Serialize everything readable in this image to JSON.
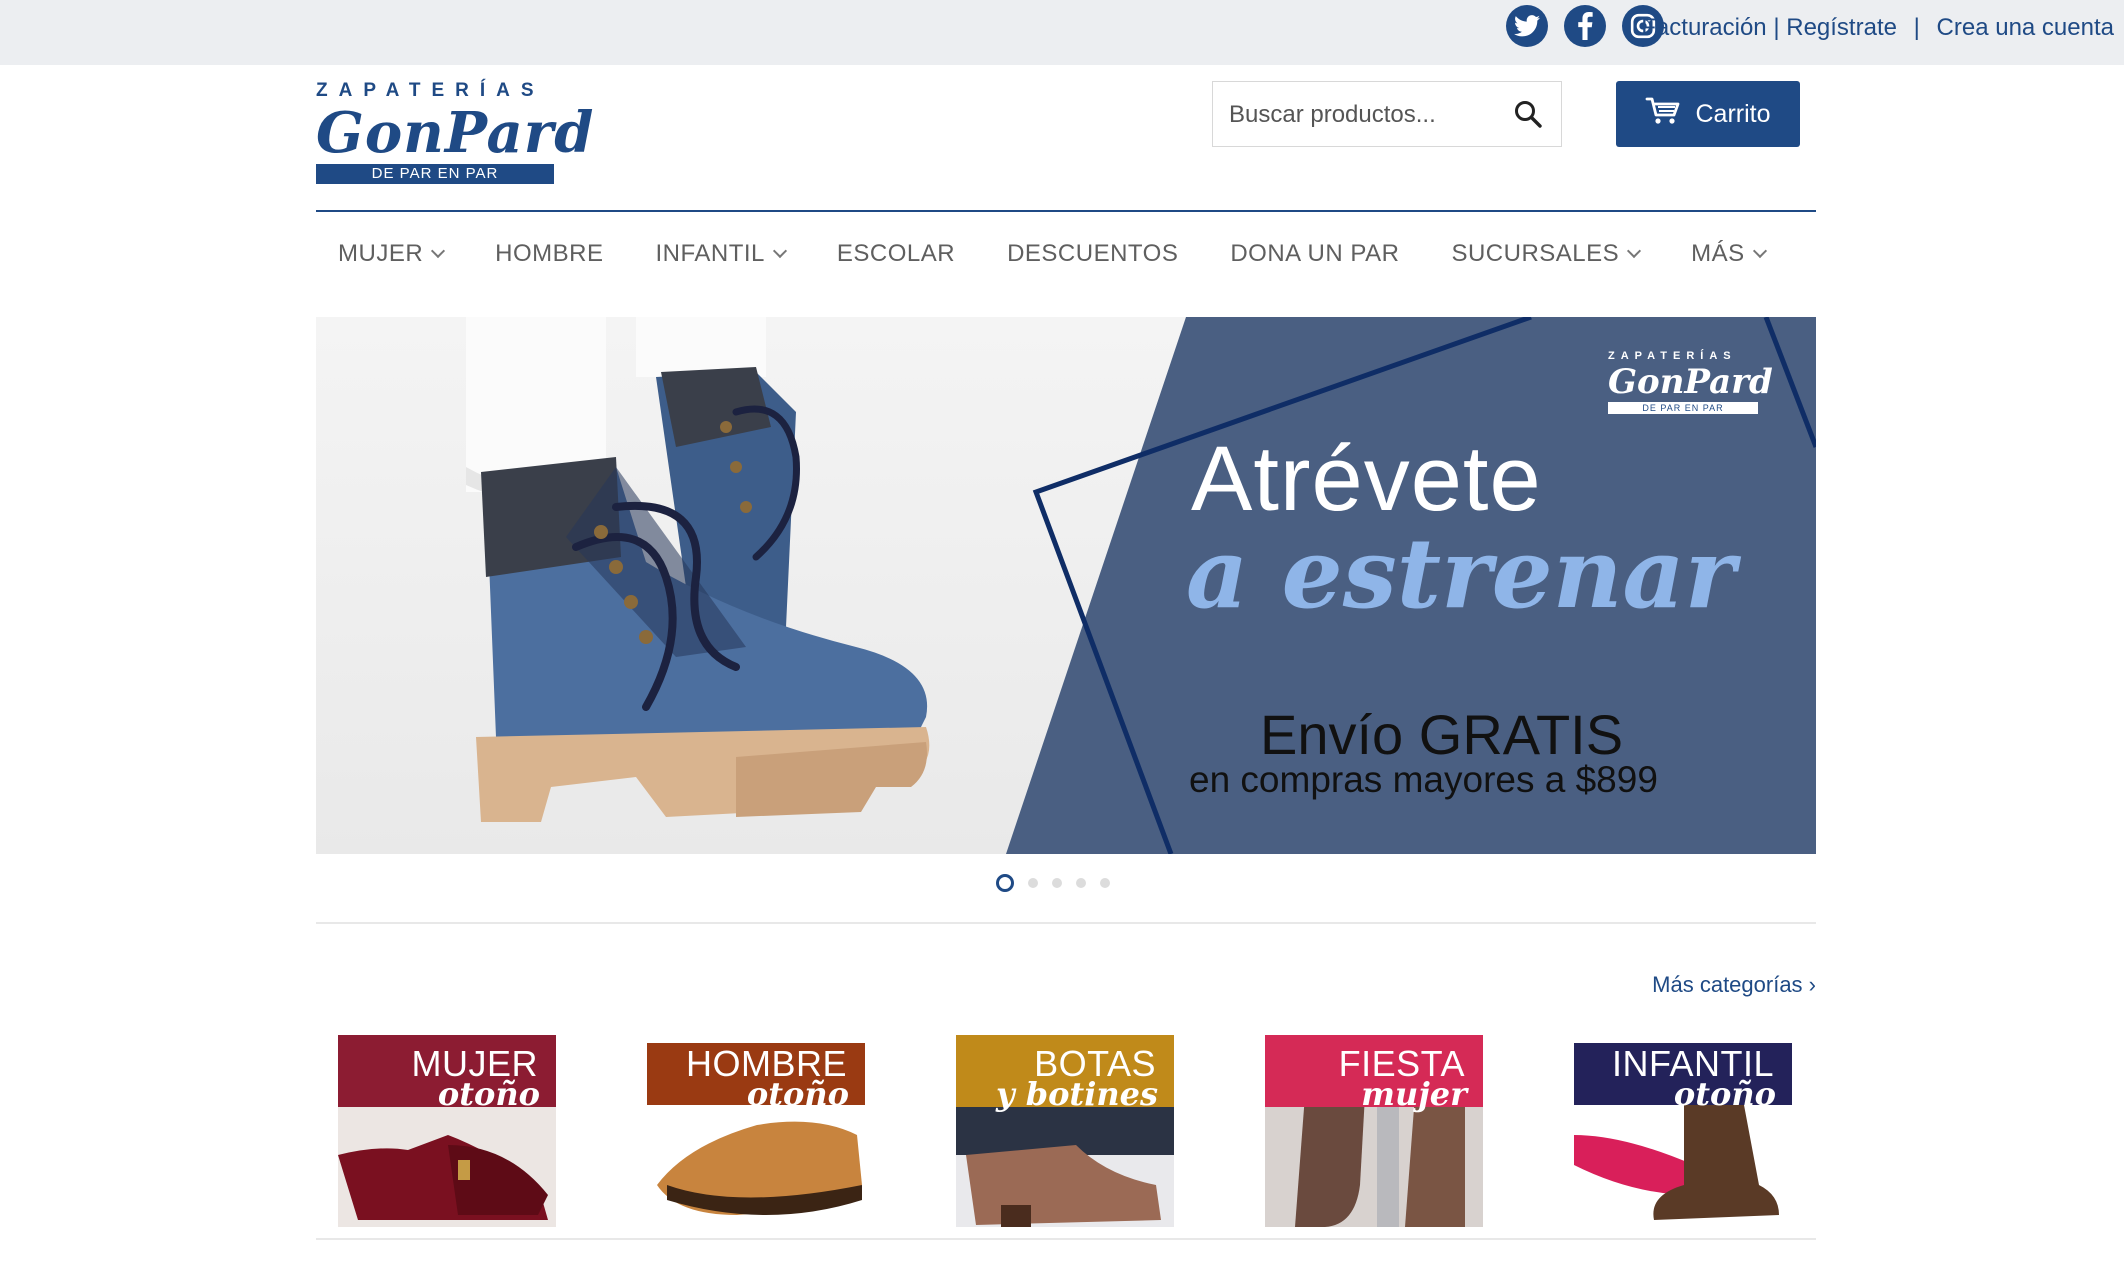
{
  "topbar": {
    "social": [
      "twitter-icon",
      "facebook-icon",
      "instagram-icon"
    ],
    "links": {
      "facturacion": "Facturación",
      "divider1": "|",
      "registrate": "Regístrate",
      "divider2": "|",
      "crea_cuenta": "Crea una cuenta"
    }
  },
  "logo": {
    "top": "ZAPATERÍAS",
    "main": "GonPard",
    "tagline": "DE PAR EN PAR"
  },
  "search": {
    "placeholder": "Buscar productos..."
  },
  "cart": {
    "label": "Carrito"
  },
  "nav": {
    "items": [
      {
        "label": "MUJER",
        "dropdown": true
      },
      {
        "label": "HOMBRE",
        "dropdown": false
      },
      {
        "label": "INFANTIL",
        "dropdown": true
      },
      {
        "label": "ESCOLAR",
        "dropdown": false
      },
      {
        "label": "DESCUENTOS",
        "dropdown": false
      },
      {
        "label": "DONA UN PAR",
        "dropdown": false
      },
      {
        "label": "SUCURSALES",
        "dropdown": true
      },
      {
        "label": "MÁS",
        "dropdown": true
      }
    ]
  },
  "hero": {
    "logo_top": "ZAPATERÍAS",
    "logo_main": "GonPard",
    "logo_tagline": "DE PAR EN PAR",
    "headline": "Atrévete",
    "headline2": "a estrenar",
    "promo": "Envío GRATIS",
    "promo_sub": "en compras mayores a $899",
    "slides_total": 5,
    "active_slide": 1
  },
  "categories": {
    "more_link": "Más categorías ›",
    "items": [
      {
        "title": "MUJER",
        "subtitle": "otoño",
        "band_color": "#8c1c32"
      },
      {
        "title": "HOMBRE",
        "subtitle": "otoño",
        "band_color": "#9a3a12"
      },
      {
        "title": "BOTAS",
        "subtitle": "y botines",
        "band_color": "#c08a1a"
      },
      {
        "title": "FIESTA",
        "subtitle": "mujer",
        "band_color": "#d52a56"
      },
      {
        "title": "INFANTIL",
        "subtitle": "otoño",
        "band_color": "#23225a"
      }
    ]
  },
  "colors": {
    "brand": "#1f4a85",
    "topbar_bg": "#eceef1",
    "hero_panel": "#4a5f82"
  }
}
